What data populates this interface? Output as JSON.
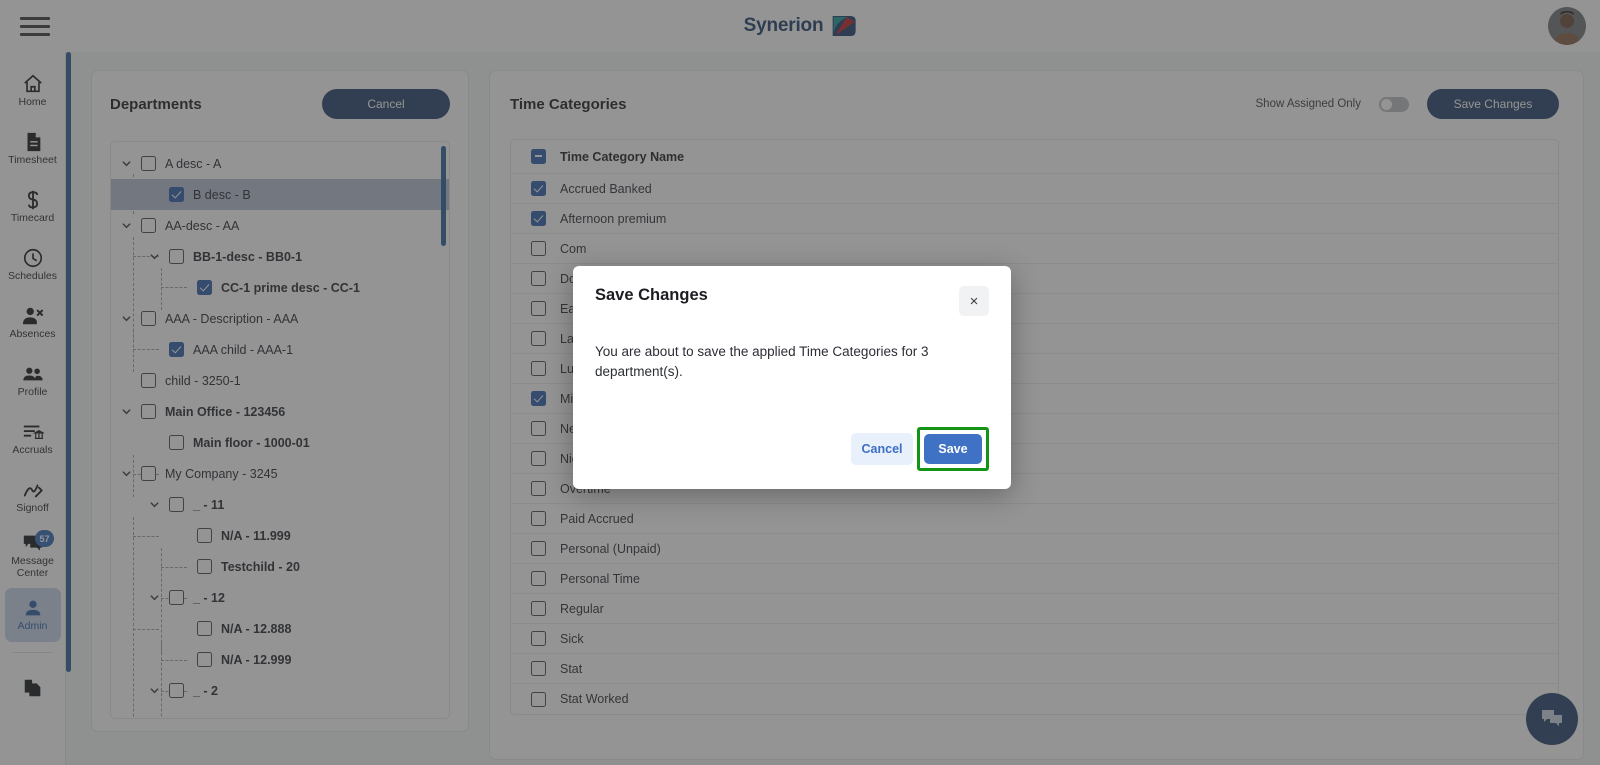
{
  "app": {
    "brand_name": "Synerion"
  },
  "topbar": {
    "menu_icon": "hamburger-icon",
    "avatar_icon": "user-avatar"
  },
  "sidebar": {
    "items": [
      {
        "label": "Home",
        "icon": "home-icon",
        "active": false
      },
      {
        "label": "Timesheet",
        "icon": "document-icon",
        "active": false
      },
      {
        "label": "Timecard",
        "icon": "dollar-icon",
        "active": false
      },
      {
        "label": "Schedules",
        "icon": "clock-icon",
        "active": false
      },
      {
        "label": "Absences",
        "icon": "person-remove-icon",
        "active": false
      },
      {
        "label": "Profile",
        "icon": "people-icon",
        "active": false
      },
      {
        "label": "Accruals",
        "icon": "list-bank-icon",
        "active": false
      },
      {
        "label": "Signoff",
        "icon": "signature-icon",
        "active": false
      },
      {
        "label": "Message Center",
        "icon": "chat-icon",
        "active": false,
        "badge": "57"
      },
      {
        "label": "Admin",
        "icon": "person-icon",
        "active": true
      }
    ],
    "footer_icon": "copy-pages-icon"
  },
  "departments": {
    "title": "Departments",
    "cancel_label": "Cancel",
    "tree": [
      {
        "label": "A desc - A",
        "depth": 0,
        "caret": true,
        "checked": false,
        "bold": false,
        "selected": false
      },
      {
        "label": "B desc - B",
        "depth": 1,
        "caret": false,
        "checked": true,
        "bold": false,
        "selected": true
      },
      {
        "label": "AA-desc - AA",
        "depth": 0,
        "caret": true,
        "checked": false,
        "bold": false,
        "selected": false
      },
      {
        "label": "BB-1-desc - BB0-1",
        "depth": 1,
        "caret": true,
        "checked": false,
        "bold": true,
        "selected": false
      },
      {
        "label": "CC-1 prime desc - CC-1",
        "depth": 2,
        "caret": false,
        "checked": true,
        "bold": true,
        "selected": false
      },
      {
        "label": "AAA - Description - AAA",
        "depth": 0,
        "caret": true,
        "checked": false,
        "bold": false,
        "selected": false
      },
      {
        "label": "AAA child - AAA-1",
        "depth": 1,
        "caret": false,
        "checked": true,
        "bold": false,
        "selected": false
      },
      {
        "label": "child - 3250-1",
        "depth": 0,
        "caret": false,
        "checked": false,
        "bold": false,
        "selected": false
      },
      {
        "label": "Main Office - 123456",
        "depth": 0,
        "caret": true,
        "checked": false,
        "bold": true,
        "selected": false
      },
      {
        "label": "Main floor - 1000-01",
        "depth": 1,
        "caret": false,
        "checked": false,
        "bold": true,
        "selected": false
      },
      {
        "label": "My Company - 3245",
        "depth": 0,
        "caret": true,
        "checked": false,
        "bold": false,
        "selected": false
      },
      {
        "label": "_ - 11",
        "depth": 1,
        "caret": true,
        "checked": false,
        "bold": true,
        "selected": false
      },
      {
        "label": "N/A - 11.999",
        "depth": 2,
        "caret": false,
        "checked": false,
        "bold": true,
        "selected": false
      },
      {
        "label": "Testchild - 20",
        "depth": 2,
        "caret": false,
        "checked": false,
        "bold": true,
        "selected": false
      },
      {
        "label": "_ - 12",
        "depth": 1,
        "caret": true,
        "checked": false,
        "bold": true,
        "selected": false
      },
      {
        "label": "N/A - 12.888",
        "depth": 2,
        "caret": false,
        "checked": false,
        "bold": true,
        "selected": false
      },
      {
        "label": "N/A - 12.999",
        "depth": 2,
        "caret": false,
        "checked": false,
        "bold": true,
        "selected": false
      },
      {
        "label": "_ - 2",
        "depth": 1,
        "caret": true,
        "checked": false,
        "bold": true,
        "selected": false
      }
    ]
  },
  "time_categories": {
    "title": "Time Categories",
    "show_assigned_label": "Show Assigned Only",
    "show_assigned_on": false,
    "save_changes_label": "Save Changes",
    "column_header": "Time Category Name",
    "header_checkbox_state": "indeterminate",
    "rows": [
      {
        "label": "Accrued Banked",
        "checked": true
      },
      {
        "label": "Afternoon premium",
        "checked": true
      },
      {
        "label": "Com",
        "checked": false
      },
      {
        "label": "Dou",
        "checked": false
      },
      {
        "label": "Earl",
        "checked": false
      },
      {
        "label": "Late",
        "checked": false
      },
      {
        "label": "Lun",
        "checked": false
      },
      {
        "label": "Mis",
        "checked": true
      },
      {
        "label": "Nev",
        "checked": false
      },
      {
        "label": "Nig",
        "checked": false
      },
      {
        "label": "Overtime",
        "checked": false
      },
      {
        "label": "Paid Accrued",
        "checked": false
      },
      {
        "label": "Personal (Unpaid)",
        "checked": false
      },
      {
        "label": "Personal Time",
        "checked": false
      },
      {
        "label": "Regular",
        "checked": false
      },
      {
        "label": "Sick",
        "checked": false
      },
      {
        "label": "Stat",
        "checked": false
      },
      {
        "label": "Stat Worked",
        "checked": false
      }
    ]
  },
  "modal": {
    "title": "Save Changes",
    "close_label": "×",
    "message": "You are about to save the applied Time Categories for 3 department(s).",
    "cancel_label": "Cancel",
    "save_label": "Save",
    "highlight_color": "#149414"
  },
  "chat": {
    "icon": "chat-bubble-icon"
  },
  "colors": {
    "accent_navy": "#26406b",
    "accent_blue": "#2f5faa",
    "rail_active_bg": "#c5d4ea",
    "primary_button": "#3f72c4"
  }
}
